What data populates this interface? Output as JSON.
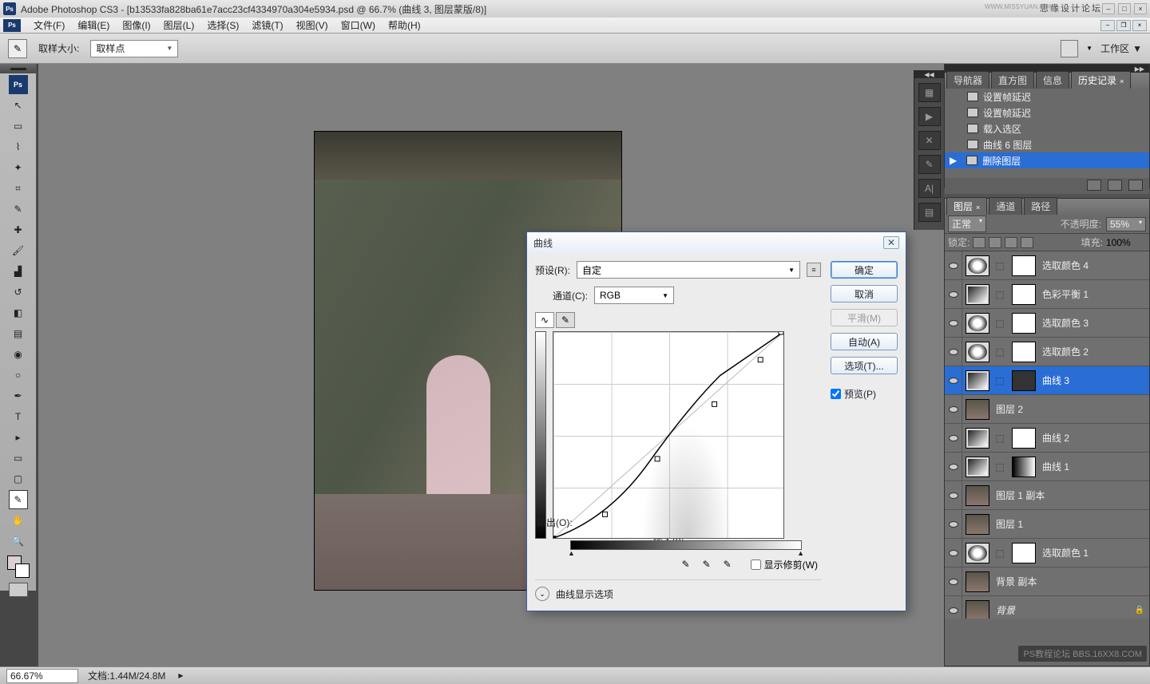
{
  "app": {
    "title": "Adobe Photoshop CS3 - [b13533fa828ba61e7acc23cf4334970a304e5934.psd @ 66.7% (曲线 3, 图层蒙版/8)]",
    "watermark_top": "思缘设计论坛",
    "watermark_url": "WWW.MISSYUAN.COM",
    "watermark_bottom": "PS教程论坛  BBS.16XX8.COM"
  },
  "menubar": {
    "items": [
      "文件(F)",
      "编辑(E)",
      "图像(I)",
      "图层(L)",
      "选择(S)",
      "滤镜(T)",
      "视图(V)",
      "窗口(W)",
      "帮助(H)"
    ]
  },
  "options": {
    "sample_label": "取样大小:",
    "sample_value": "取样点",
    "workspace_label": "工作区"
  },
  "history_panel": {
    "tabs": [
      "导航器",
      "直方图",
      "信息",
      "历史记录"
    ],
    "active_tab": 3,
    "items": [
      {
        "label": "设置帧延迟"
      },
      {
        "label": "设置帧延迟"
      },
      {
        "label": "载入选区"
      },
      {
        "label": "曲线 6 图层"
      },
      {
        "label": "删除图层",
        "selected": true
      }
    ]
  },
  "layers_panel": {
    "tabs": [
      "图层",
      "通道",
      "路径"
    ],
    "active_tab": 0,
    "blend_mode": "正常",
    "opacity_label": "不透明度:",
    "opacity_value": "55%",
    "lock_label": "锁定:",
    "fill_label": "填充:",
    "fill_value": "100%",
    "layers": [
      {
        "name": "选取颜色 4",
        "thumb": "adj",
        "mask": "white"
      },
      {
        "name": "色彩平衡 1",
        "thumb": "curves",
        "mask": "white"
      },
      {
        "name": "选取颜色 3",
        "thumb": "adj",
        "mask": "white"
      },
      {
        "name": "选取颜色 2",
        "thumb": "adj",
        "mask": "white"
      },
      {
        "name": "曲线 3",
        "thumb": "curves",
        "mask": "dark",
        "selected": true
      },
      {
        "name": "图层 2",
        "thumb": "img"
      },
      {
        "name": "曲线 2",
        "thumb": "curves",
        "mask": "white"
      },
      {
        "name": "曲线 1",
        "thumb": "curves",
        "mask": "grad"
      },
      {
        "name": "图层 1 副本",
        "thumb": "img"
      },
      {
        "name": "图层 1",
        "thumb": "img"
      },
      {
        "name": "选取颜色 1",
        "thumb": "adj",
        "mask": "white"
      },
      {
        "name": "背景 副本",
        "thumb": "img"
      },
      {
        "name": "背景",
        "thumb": "img",
        "locked": true,
        "italic": true
      }
    ]
  },
  "curves_dialog": {
    "title": "曲线",
    "preset_label": "预设(R):",
    "preset_value": "自定",
    "channel_label": "通道(C):",
    "channel_value": "RGB",
    "output_label": "输出(O):",
    "input_label": "输入(I):",
    "show_clip_label": "显示修剪(W)",
    "expand_label": "曲线显示选项",
    "ok": "确定",
    "cancel": "取消",
    "smooth": "平滑(M)",
    "auto": "自动(A)",
    "options_btn": "选项(T)...",
    "preview_label": "预览(P)"
  },
  "statusbar": {
    "zoom": "66.67%",
    "doc_label": "文档:1.44M/24.8M"
  },
  "chart_data": {
    "type": "line",
    "title": "曲线 (RGB)",
    "xlabel": "输入",
    "ylabel": "输出",
    "xlim": [
      0,
      255
    ],
    "ylim": [
      0,
      255
    ],
    "series": [
      {
        "name": "curve",
        "values": [
          [
            0,
            0
          ],
          [
            57,
            30
          ],
          [
            115,
            99
          ],
          [
            179,
            167
          ],
          [
            229,
            221
          ],
          [
            255,
            255
          ]
        ]
      }
    ]
  }
}
